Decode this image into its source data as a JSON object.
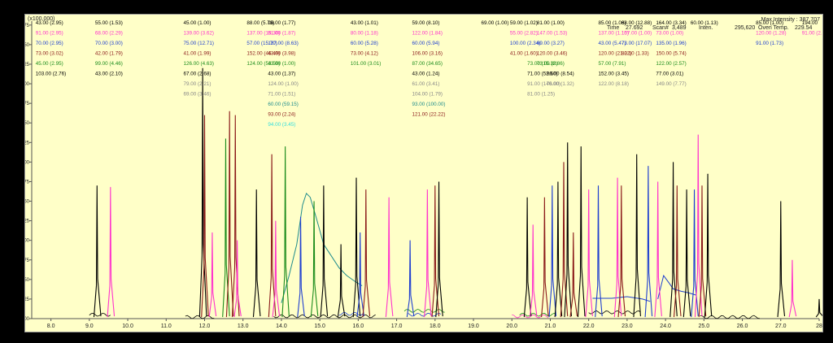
{
  "header": {
    "scale_note": "(x100,000)",
    "max_intensity": "Max Intensity : 387,707",
    "time_label": "Time",
    "time_value": "27.692",
    "scan_label": "Scan#",
    "scan_value": "3,489",
    "inten_label": "Inten.",
    "inten_value": "295,620",
    "oven_label": "Oven Temp.",
    "oven_value": "229.54"
  },
  "colors": {
    "background": "#ffffc8",
    "black": "#000000",
    "magenta": "#ff33cc",
    "blue": "#1f3fd0",
    "green": "#1c8c1c",
    "maroon": "#8b1a1a",
    "gray": "#888888",
    "teal": "#1f8c8c",
    "cyan": "#33dddd",
    "orange": "#c86400"
  },
  "chart_data": {
    "type": "line",
    "title": "",
    "xlabel": "",
    "ylabel": "",
    "y_unit_note": "(x100,000)",
    "xlim": [
      7.5,
      28.0
    ],
    "ylim": [
      0.0,
      3.8
    ],
    "x_ticks": [
      "8.0",
      "9.0",
      "10.0",
      "11.0",
      "12.0",
      "13.0",
      "14.0",
      "15.0",
      "16.0",
      "17.0",
      "18.0",
      "19.0",
      "20.0",
      "21.0",
      "22.0",
      "23.0",
      "24.0",
      "25.0",
      "26.0",
      "27.0",
      "28"
    ],
    "y_ticks": [
      "0.00",
      "0.25",
      "0.50",
      "0.75",
      "1.00",
      "1.25",
      "1.50",
      "1.75",
      "2.00",
      "2.25",
      "2.50",
      "2.75",
      "3.00",
      "3.25",
      "3.50",
      "3.75"
    ],
    "grid": false,
    "peaks": [
      {
        "x": 9.2,
        "y": 1.7,
        "color": "black"
      },
      {
        "x": 9.55,
        "y": 1.68,
        "color": "magenta"
      },
      {
        "x": 11.95,
        "y": 3.2,
        "color": "black"
      },
      {
        "x": 12.0,
        "y": 2.6,
        "color": "maroon"
      },
      {
        "x": 12.2,
        "y": 1.1,
        "color": "magenta"
      },
      {
        "x": 12.55,
        "y": 2.3,
        "color": "green"
      },
      {
        "x": 12.65,
        "y": 2.65,
        "color": "maroon"
      },
      {
        "x": 12.8,
        "y": 2.6,
        "color": "maroon"
      },
      {
        "x": 12.85,
        "y": 1.0,
        "color": "magenta"
      },
      {
        "x": 13.35,
        "y": 1.65,
        "color": "black"
      },
      {
        "x": 13.75,
        "y": 2.1,
        "color": "maroon"
      },
      {
        "x": 13.85,
        "y": 1.25,
        "color": "magenta"
      },
      {
        "x": 14.1,
        "y": 2.2,
        "color": "green"
      },
      {
        "x": 14.5,
        "y": 1.3,
        "color": "blue"
      },
      {
        "x": 14.85,
        "y": 1.5,
        "color": "green"
      },
      {
        "x": 15.1,
        "y": 1.7,
        "color": "black"
      },
      {
        "x": 15.55,
        "y": 0.95,
        "color": "black"
      },
      {
        "x": 15.95,
        "y": 1.8,
        "color": "black"
      },
      {
        "x": 16.05,
        "y": 1.1,
        "color": "blue"
      },
      {
        "x": 16.2,
        "y": 1.65,
        "color": "maroon"
      },
      {
        "x": 16.8,
        "y": 1.55,
        "color": "magenta"
      },
      {
        "x": 17.35,
        "y": 1.0,
        "color": "blue"
      },
      {
        "x": 17.8,
        "y": 1.65,
        "color": "magenta"
      },
      {
        "x": 18.0,
        "y": 1.7,
        "color": "maroon"
      },
      {
        "x": 18.1,
        "y": 1.75,
        "color": "black"
      },
      {
        "x": 20.4,
        "y": 1.55,
        "color": "black"
      },
      {
        "x": 20.55,
        "y": 1.2,
        "color": "magenta"
      },
      {
        "x": 20.85,
        "y": 1.55,
        "color": "maroon"
      },
      {
        "x": 21.05,
        "y": 1.7,
        "color": "blue"
      },
      {
        "x": 21.2,
        "y": 1.75,
        "color": "black"
      },
      {
        "x": 21.35,
        "y": 2.0,
        "color": "maroon"
      },
      {
        "x": 21.45,
        "y": 2.25,
        "color": "black"
      },
      {
        "x": 21.6,
        "y": 1.1,
        "color": "maroon"
      },
      {
        "x": 21.8,
        "y": 2.2,
        "color": "black"
      },
      {
        "x": 22.0,
        "y": 1.65,
        "color": "magenta"
      },
      {
        "x": 22.25,
        "y": 1.7,
        "color": "blue"
      },
      {
        "x": 22.75,
        "y": 1.8,
        "color": "magenta"
      },
      {
        "x": 22.85,
        "y": 1.7,
        "color": "maroon"
      },
      {
        "x": 23.25,
        "y": 2.1,
        "color": "black"
      },
      {
        "x": 23.55,
        "y": 1.95,
        "color": "blue"
      },
      {
        "x": 23.8,
        "y": 1.75,
        "color": "magenta"
      },
      {
        "x": 24.2,
        "y": 2.0,
        "color": "black"
      },
      {
        "x": 24.3,
        "y": 1.7,
        "color": "maroon"
      },
      {
        "x": 24.55,
        "y": 1.65,
        "color": "black"
      },
      {
        "x": 24.75,
        "y": 1.65,
        "color": "blue"
      },
      {
        "x": 24.85,
        "y": 2.35,
        "color": "magenta"
      },
      {
        "x": 24.95,
        "y": 1.7,
        "color": "maroon"
      },
      {
        "x": 25.1,
        "y": 1.85,
        "color": "black"
      },
      {
        "x": 27.0,
        "y": 1.5,
        "color": "black"
      },
      {
        "x": 27.3,
        "y": 0.75,
        "color": "magenta"
      },
      {
        "x": 28.0,
        "y": 0.25,
        "color": "black"
      }
    ],
    "broad_features": [
      {
        "color": "teal",
        "x": [
          14.0,
          14.2,
          14.4,
          14.55,
          14.65,
          14.75,
          14.9,
          15.1,
          15.3,
          15.5,
          15.7,
          15.9,
          16.1
        ],
        "y": [
          0.2,
          0.55,
          0.95,
          1.45,
          1.6,
          1.55,
          1.3,
          0.95,
          0.8,
          0.65,
          0.55,
          0.48,
          0.42
        ]
      },
      {
        "color": "blue",
        "x": [
          23.8,
          23.95,
          24.1,
          24.2,
          24.4,
          24.6,
          24.8
        ],
        "y": [
          0.25,
          0.55,
          0.45,
          0.38,
          0.35,
          0.33,
          0.3
        ]
      },
      {
        "color": "blue",
        "x": [
          22.1,
          22.6,
          23.0,
          23.4,
          23.6
        ],
        "y": [
          0.26,
          0.26,
          0.28,
          0.25,
          0.22
        ]
      }
    ],
    "annotations": [
      {
        "x": 7.6,
        "y": 3.78,
        "color": "black",
        "text": "43.00 (2.95)"
      },
      {
        "x": 7.6,
        "y": 3.65,
        "color": "magenta",
        "text": "91.00 (2.95)"
      },
      {
        "x": 7.6,
        "y": 3.52,
        "color": "blue",
        "text": "70.00 (2.95)"
      },
      {
        "x": 7.6,
        "y": 3.39,
        "color": "maroon",
        "text": "73.00 (3.02)"
      },
      {
        "x": 7.6,
        "y": 3.26,
        "color": "green",
        "text": "45.00 (2.95)"
      },
      {
        "x": 7.6,
        "y": 3.13,
        "color": "black",
        "text": "103.00 (2.76)"
      },
      {
        "x": 9.15,
        "y": 3.78,
        "color": "black",
        "text": "55.00 (1.53)"
      },
      {
        "x": 9.15,
        "y": 3.65,
        "color": "magenta",
        "text": "68.00 (2.29)"
      },
      {
        "x": 9.15,
        "y": 3.52,
        "color": "blue",
        "text": "70.00 (3.00)"
      },
      {
        "x": 9.15,
        "y": 3.39,
        "color": "maroon",
        "text": "42.00 (1.79)"
      },
      {
        "x": 9.15,
        "y": 3.26,
        "color": "green",
        "text": "99.00 (4.46)"
      },
      {
        "x": 9.15,
        "y": 3.13,
        "color": "black",
        "text": "43.00 (2.10)"
      },
      {
        "x": 11.45,
        "y": 3.78,
        "color": "black",
        "text": "45.00 (1.00)"
      },
      {
        "x": 11.45,
        "y": 3.65,
        "color": "magenta",
        "text": "139.00 (3.62)"
      },
      {
        "x": 11.45,
        "y": 3.52,
        "color": "blue",
        "text": "75.00 (12.71)"
      },
      {
        "x": 11.45,
        "y": 3.39,
        "color": "maroon",
        "text": "41.00 (1.99)"
      },
      {
        "x": 11.45,
        "y": 3.26,
        "color": "green",
        "text": "126.00 (4.63)"
      },
      {
        "x": 11.45,
        "y": 3.13,
        "color": "black",
        "text": "67.00 (2.68)"
      },
      {
        "x": 11.45,
        "y": 3.0,
        "color": "gray",
        "text": "79.00 (2.21)"
      },
      {
        "x": 11.45,
        "y": 2.87,
        "color": "gray",
        "text": "69.00 (3.46)"
      },
      {
        "x": 13.1,
        "y": 3.78,
        "color": "black",
        "text": "88.00 (5.73)"
      },
      {
        "x": 13.1,
        "y": 3.65,
        "color": "magenta",
        "text": "137.00 (15.30)"
      },
      {
        "x": 13.1,
        "y": 3.52,
        "color": "blue",
        "text": "57.00 (15.70)"
      },
      {
        "x": 13.1,
        "y": 3.39,
        "color": "maroon",
        "text": "152.00 (46.49)"
      },
      {
        "x": 13.1,
        "y": 3.26,
        "color": "green",
        "text": "124.00 (53.59)"
      },
      {
        "x": 13.65,
        "y": 3.78,
        "color": "black",
        "text": "96.00 (1.77)"
      },
      {
        "x": 13.65,
        "y": 3.65,
        "color": "magenta",
        "text": "81.00 (1.87)"
      },
      {
        "x": 13.65,
        "y": 3.52,
        "color": "blue",
        "text": "137.00 (8.63)"
      },
      {
        "x": 13.65,
        "y": 3.39,
        "color": "maroon",
        "text": "43.00 (3.98)"
      },
      {
        "x": 13.65,
        "y": 3.26,
        "color": "green",
        "text": "43.00 (1.00)"
      },
      {
        "x": 13.65,
        "y": 3.13,
        "color": "black",
        "text": "43.00 (1.37)"
      },
      {
        "x": 13.65,
        "y": 3.0,
        "color": "gray",
        "text": "124.00 (1.00)"
      },
      {
        "x": 13.65,
        "y": 2.87,
        "color": "gray",
        "text": "71.00 (1.51)"
      },
      {
        "x": 13.65,
        "y": 2.74,
        "color": "teal",
        "text": "60.00 (59.15)"
      },
      {
        "x": 13.65,
        "y": 2.61,
        "color": "maroon",
        "text": "93.00 (2.24)"
      },
      {
        "x": 13.65,
        "y": 2.48,
        "color": "cyan",
        "text": "94.00 (3.45)"
      },
      {
        "x": 15.8,
        "y": 3.78,
        "color": "black",
        "text": "43.00 (1.01)"
      },
      {
        "x": 15.8,
        "y": 3.65,
        "color": "magenta",
        "text": "80.00 (1.18)"
      },
      {
        "x": 15.8,
        "y": 3.52,
        "color": "blue",
        "text": "60.00 (5.28)"
      },
      {
        "x": 15.8,
        "y": 3.39,
        "color": "maroon",
        "text": "73.00 (4.12)"
      },
      {
        "x": 15.8,
        "y": 3.26,
        "color": "green",
        "text": "101.00 (3.01)"
      },
      {
        "x": 17.4,
        "y": 3.78,
        "color": "black",
        "text": "59.00 (8.10)"
      },
      {
        "x": 17.4,
        "y": 3.65,
        "color": "magenta",
        "text": "122.00 (1.84)"
      },
      {
        "x": 17.4,
        "y": 3.52,
        "color": "blue",
        "text": "60.00 (5.94)"
      },
      {
        "x": 17.4,
        "y": 3.39,
        "color": "maroon",
        "text": "106.00 (3.16)"
      },
      {
        "x": 17.4,
        "y": 3.26,
        "color": "green",
        "text": "87.00 (34.65)"
      },
      {
        "x": 17.4,
        "y": 3.13,
        "color": "black",
        "text": "43.00 (1.24)"
      },
      {
        "x": 17.4,
        "y": 3.0,
        "color": "gray",
        "text": "61.00 (3.41)"
      },
      {
        "x": 17.4,
        "y": 2.87,
        "color": "gray",
        "text": "104.00 (1.79)"
      },
      {
        "x": 17.4,
        "y": 2.74,
        "color": "teal",
        "text": "93.00 (100.00)"
      },
      {
        "x": 17.4,
        "y": 2.61,
        "color": "maroon",
        "text": "121.00 (22.22)"
      },
      {
        "x": 19.2,
        "y": 3.78,
        "color": "black",
        "text": "69.00 (1.00)"
      },
      {
        "x": 19.95,
        "y": 3.78,
        "color": "black",
        "text": "59.00 (1.02)"
      },
      {
        "x": 19.95,
        "y": 3.65,
        "color": "magenta",
        "text": "55.00 (2.82)"
      },
      {
        "x": 19.95,
        "y": 3.52,
        "color": "blue",
        "text": "100.00 (2.34)"
      },
      {
        "x": 19.95,
        "y": 3.39,
        "color": "maroon",
        "text": "41.00 (1.60)"
      },
      {
        "x": 20.65,
        "y": 3.78,
        "color": "black",
        "text": "81.00 (1.00)"
      },
      {
        "x": 20.65,
        "y": 3.65,
        "color": "magenta",
        "text": "147.00 (1.53)"
      },
      {
        "x": 20.65,
        "y": 3.52,
        "color": "blue",
        "text": "69.00 (3.27)"
      },
      {
        "x": 20.65,
        "y": 3.39,
        "color": "maroon",
        "text": "120.00 (3.46)"
      },
      {
        "x": 20.65,
        "y": 3.26,
        "color": "green",
        "text": "73.00 (2.86)"
      },
      {
        "x": 20.4,
        "y": 3.26,
        "color": "green",
        "text": "73.00 (15.38)"
      },
      {
        "x": 20.4,
        "y": 3.13,
        "color": "black",
        "text": "71.00 (52.60)"
      },
      {
        "x": 20.4,
        "y": 3.0,
        "color": "gray",
        "text": "91.00 (140.00)"
      },
      {
        "x": 20.4,
        "y": 2.87,
        "color": "gray",
        "text": "81.00 (1.25)"
      },
      {
        "x": 20.9,
        "y": 3.13,
        "color": "black",
        "text": "86.00 (8.54)"
      },
      {
        "x": 20.9,
        "y": 3.0,
        "color": "gray",
        "text": "76.00 (1.32)"
      },
      {
        "x": 22.25,
        "y": 3.78,
        "color": "black",
        "text": "85.00 (1.06)"
      },
      {
        "x": 22.25,
        "y": 3.65,
        "color": "magenta",
        "text": "137.00 (1.15)"
      },
      {
        "x": 22.25,
        "y": 3.52,
        "color": "blue",
        "text": "43.00 (5.47)"
      },
      {
        "x": 22.25,
        "y": 3.39,
        "color": "maroon",
        "text": "120.00 (21.02)"
      },
      {
        "x": 22.25,
        "y": 3.26,
        "color": "green",
        "text": "57.00 (7.91)"
      },
      {
        "x": 22.25,
        "y": 3.13,
        "color": "black",
        "text": "152.00 (3.45)"
      },
      {
        "x": 22.25,
        "y": 3.0,
        "color": "gray",
        "text": "122.00 (8.18)"
      },
      {
        "x": 22.85,
        "y": 3.78,
        "color": "black",
        "text": "88.00 (12.88)"
      },
      {
        "x": 22.85,
        "y": 3.65,
        "color": "magenta",
        "text": "107.00 (1.00)"
      },
      {
        "x": 22.85,
        "y": 3.52,
        "color": "blue",
        "text": "73.00 (17.07)"
      },
      {
        "x": 22.85,
        "y": 3.39,
        "color": "maroon",
        "text": "82.00 (1.33)"
      },
      {
        "x": 23.75,
        "y": 3.78,
        "color": "black",
        "text": "164.00 (3.34)"
      },
      {
        "x": 23.75,
        "y": 3.65,
        "color": "magenta",
        "text": "73.00 (1.00)"
      },
      {
        "x": 23.75,
        "y": 3.52,
        "color": "blue",
        "text": "135.00 (1.96)"
      },
      {
        "x": 23.75,
        "y": 3.39,
        "color": "maroon",
        "text": "150.00 (5.74)"
      },
      {
        "x": 23.75,
        "y": 3.26,
        "color": "green",
        "text": "122.00 (2.57)"
      },
      {
        "x": 23.75,
        "y": 3.13,
        "color": "black",
        "text": "77.00 (3.01)"
      },
      {
        "x": 23.75,
        "y": 3.0,
        "color": "gray",
        "text": "149.00 (7.77)"
      },
      {
        "x": 24.65,
        "y": 3.78,
        "color": "black",
        "text": "60.00 (1.13)"
      },
      {
        "x": 26.35,
        "y": 3.78,
        "color": "black",
        "text": "85.00 (1.00)"
      },
      {
        "x": 26.35,
        "y": 3.65,
        "color": "magenta",
        "text": "120.00 (1.28)"
      },
      {
        "x": 26.35,
        "y": 3.52,
        "color": "blue",
        "text": "91.00 (1.73)"
      },
      {
        "x": 27.55,
        "y": 3.78,
        "color": "black",
        "text": "194.00"
      },
      {
        "x": 27.55,
        "y": 3.65,
        "color": "magenta",
        "text": "91.00 (2."
      }
    ]
  }
}
